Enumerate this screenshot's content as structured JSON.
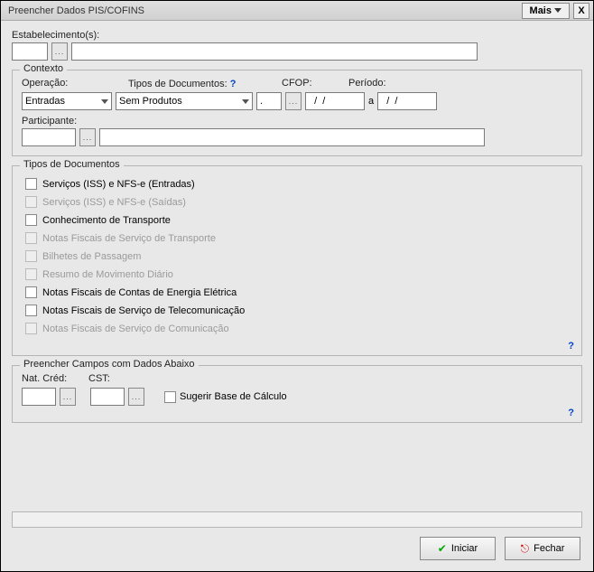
{
  "title": "Preencher Dados PIS/COFINS",
  "buttons": {
    "mais": "Mais",
    "close": "X",
    "iniciar": "Iniciar",
    "fechar": "Fechar"
  },
  "labels": {
    "estabelecimentos": "Estabelecimento(s):",
    "contexto": "Contexto",
    "operacao": "Operação:",
    "tipos_doc": "Tipos de Documentos:",
    "cfop": "CFOP:",
    "periodo": "Período:",
    "a": "a",
    "participante": "Participante:",
    "tipos_documentos": "Tipos de Documentos",
    "preencher": "Preencher Campos com Dados Abaixo",
    "nat_cred": "Nat. Créd:",
    "cst": "CST:",
    "sugerir": "Sugerir Base de Cálculo",
    "help": "?"
  },
  "values": {
    "operacao": "Entradas",
    "tipos_doc": "Sem Produtos",
    "cfop": ".",
    "periodo1": "  /  /",
    "periodo2": "  /  /",
    "estab_code": "",
    "estab_desc": "",
    "participante_code": "",
    "participante_desc": "",
    "nat_cred": "",
    "cst": ""
  },
  "doc_types": [
    {
      "label": "Serviços (ISS) e NFS-e (Entradas)",
      "disabled": false
    },
    {
      "label": "Serviços (ISS)  e NFS-e (Saídas)",
      "disabled": true
    },
    {
      "label": "Conhecimento de Transporte",
      "disabled": false
    },
    {
      "label": "Notas Fiscais de Serviço de Transporte",
      "disabled": true
    },
    {
      "label": "Bilhetes de Passagem",
      "disabled": true
    },
    {
      "label": "Resumo de Movimento Diário",
      "disabled": true
    },
    {
      "label": "Notas Fiscais de Contas de Energia Elétrica",
      "disabled": false
    },
    {
      "label": "Notas Fiscais de Serviço de Telecomunicação",
      "disabled": false
    },
    {
      "label": "Notas Fiscais de Serviço de Comunicação",
      "disabled": true
    }
  ]
}
